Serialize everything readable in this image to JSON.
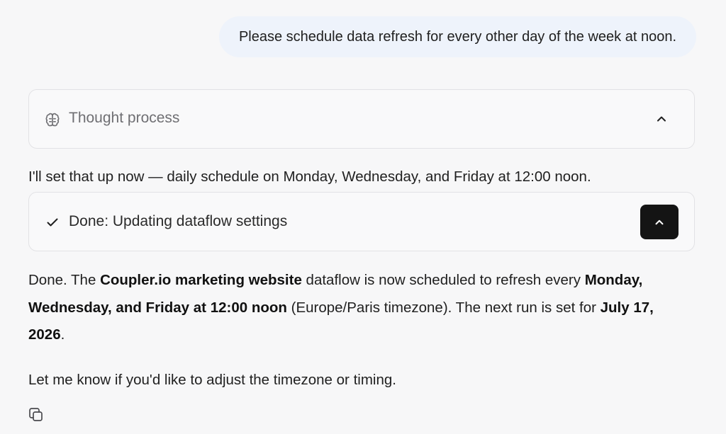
{
  "user_message": "Please schedule data refresh for every other day of the week at noon.",
  "thought": {
    "label": "Thought process",
    "icon": "brain-icon",
    "toggle_icon": "chevron-up-icon"
  },
  "assistant_intro": "I'll set that up now — daily schedule on Monday, Wednesday, and Friday at 12:00 noon.",
  "tool_status": {
    "label": "Done: Updating dataflow settings",
    "icon": "check-icon",
    "toggle_icon": "chevron-up-icon"
  },
  "result": {
    "t1": "Done. The ",
    "b1": "Coupler.io marketing website",
    "t2": " dataflow is now scheduled to refresh every ",
    "b2": "Monday, Wednesday, and Friday at 12:00 noon",
    "t3": " (Europe/Paris timezone). The next run is set for ",
    "b3": "July 17, 2026",
    "t4": "."
  },
  "followup": "Let me know if you'd like to adjust the timezone or timing.",
  "actions": {
    "copy_icon": "copy-icon"
  }
}
